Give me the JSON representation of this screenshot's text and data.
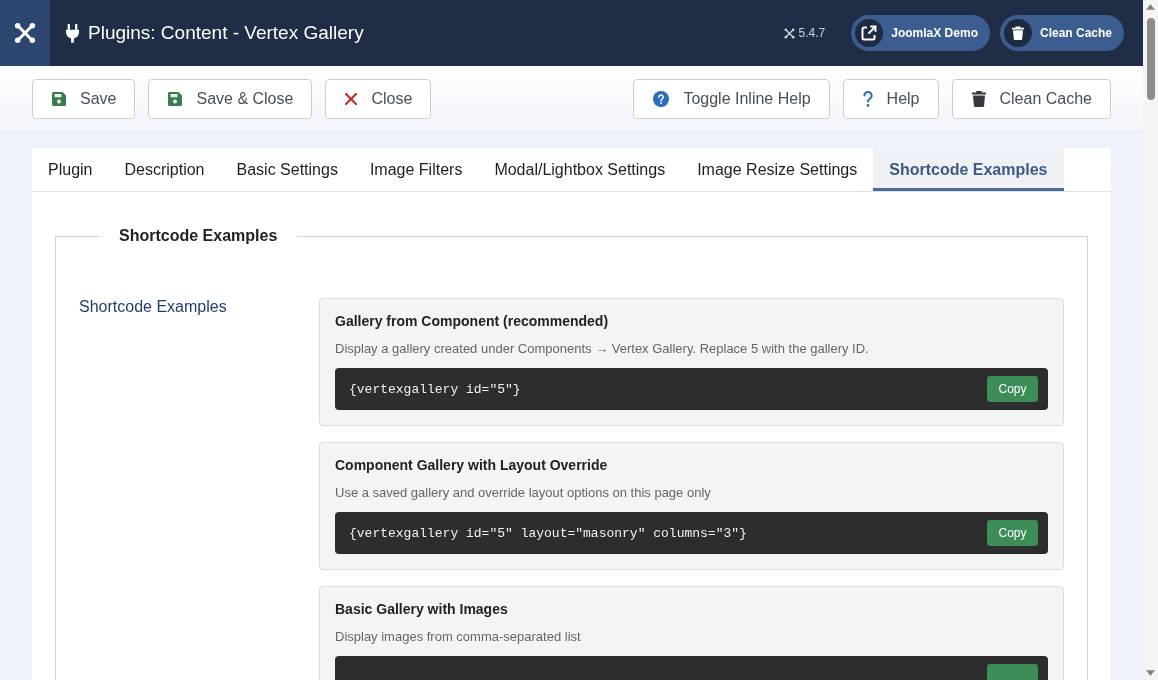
{
  "header": {
    "title": "Plugins: Content - Vertex Gallery",
    "version": "5.4.7",
    "actions": [
      {
        "label": "JoomlaX Demo"
      },
      {
        "label": "Clean Cache"
      }
    ]
  },
  "toolbar": {
    "left": [
      {
        "label": "Save"
      },
      {
        "label": "Save & Close"
      },
      {
        "label": "Close"
      }
    ],
    "right": [
      {
        "label": "Toggle Inline Help"
      },
      {
        "label": "Help"
      },
      {
        "label": "Clean Cache"
      }
    ]
  },
  "tabs": [
    {
      "label": "Plugin",
      "selected": false
    },
    {
      "label": "Description",
      "selected": false
    },
    {
      "label": "Basic Settings",
      "selected": false
    },
    {
      "label": "Image Filters",
      "selected": false
    },
    {
      "label": "Modal/Lightbox Settings",
      "selected": false
    },
    {
      "label": "Image Resize Settings",
      "selected": false
    },
    {
      "label": "Shortcode Examples",
      "selected": true
    }
  ],
  "fieldset": {
    "legend": "Shortcode Examples",
    "label": "Shortcode Examples",
    "cards": [
      {
        "title": "Gallery from Component (recommended)",
        "description": "Display a gallery created under Components → Vertex Gallery. Replace 5 with the gallery ID.",
        "code_block": {
          "text": "{vertexgallery id=\"5\"}",
          "copy_label": "Copy"
        }
      },
      {
        "title": "Component Gallery with Layout Override",
        "description": "Use a saved gallery and override layout options on this page only",
        "code_block": {
          "text": "{vertexgallery id=\"5\" layout=\"masonry\" columns=\"3\"}",
          "copy_label": "Copy"
        }
      },
      {
        "title": "Basic Gallery with Images",
        "description": "Display images from comma-separated list",
        "code_block": {
          "cut_off": true
        }
      }
    ]
  }
}
